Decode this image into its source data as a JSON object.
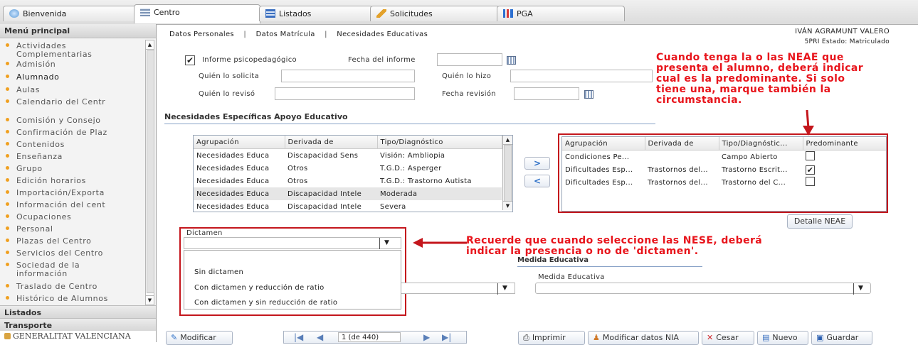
{
  "tabs": [
    {
      "label": "Bienvenida",
      "icon": "globe-icon"
    },
    {
      "label": "Centro",
      "icon": "grid-icon"
    },
    {
      "label": "Listados",
      "icon": "list-icon"
    },
    {
      "label": "Solicitudes",
      "icon": "pencil-icon"
    },
    {
      "label": "PGA",
      "icon": "bar-chart-icon"
    }
  ],
  "sidebar": {
    "title": "Menú principal",
    "items": [
      "Actividades",
      "Complementarias",
      "Admisión",
      "Alumnado",
      "Aulas",
      "Calendario del Centr",
      "Comisión y Consejo",
      "Confirmación de Plaz",
      "Contenidos",
      "Enseñanza",
      "Grupo",
      "Edición horarios",
      "Importación/Exporta",
      "Información del cent",
      "Ocupaciones",
      "Personal",
      "Plazas del Centro",
      "Servicios del Centro",
      "Sociedad de la",
      "información",
      "Traslado de Centro",
      "Histórico de Alumnos"
    ],
    "selected": "Alumnado",
    "sections": [
      "Listados",
      "Transporte"
    ],
    "footer": "GENERALITAT VALENCIANA"
  },
  "subnav": [
    "Datos Personales",
    "Datos Matrícula",
    "Necesidades Educativas"
  ],
  "student": {
    "name": "IVÁN AGRAMUNT VALERO",
    "status": "5PRI Estado: Matriculado"
  },
  "form": {
    "informe_label": "Informe psicopedagógico",
    "informe_checked": true,
    "fecha_informe_label": "Fecha del informe",
    "fecha_informe_value": "",
    "solicita_label": "Quién lo solicita",
    "solicita_value": "",
    "hizo_label": "Quién lo hizo",
    "hizo_value": "",
    "reviso_label": "Quién lo revisó",
    "reviso_value": "",
    "fecha_revision_label": "Fecha revisión",
    "fecha_revision_value": ""
  },
  "annotations": {
    "top_right": [
      "Cuando tenga la o las NEAE que",
      "presenta el alumno, deberá indicar",
      "cual es la predominante. Si solo",
      "tiene una, marque también la",
      "circumstancia."
    ],
    "middle": [
      "Recuerde que cuando seleccione las NESE, deberá",
      "indicar la presencia o no de 'dictamen'."
    ],
    "accent_color": "#e8141b"
  },
  "neae": {
    "section_title": "Necesidades Específicas Apoyo Educativo",
    "left_columns": [
      "Agrupación",
      "Derivada de",
      "Tipo/Diagnóstico"
    ],
    "left_rows": [
      [
        "Necesidades Educa",
        "Discapacidad Sens",
        "Visión: Ambliopia"
      ],
      [
        "Necesidades Educa",
        "Otros",
        "T.G.D.: Asperger"
      ],
      [
        "Necesidades Educa",
        "Otros",
        "T.G.D.: Trastorno Autista"
      ],
      [
        "Necesidades Educa",
        "Discapacidad Intele",
        "Moderada"
      ],
      [
        "Necesidades Educa",
        "Discapacidad Intele",
        "Severa"
      ]
    ],
    "move_right": ">",
    "move_left": "<",
    "right_columns": [
      "Agrupación",
      "Derivada de",
      "Tipo/Diagnóstic...",
      "Predominante"
    ],
    "right_rows": [
      {
        "agrupacion": "Condiciones Pe...",
        "derivada": "",
        "tipo": "Campo Abierto",
        "predominante": false
      },
      {
        "agrupacion": "Dificultades Esp...",
        "derivada": "Trastornos del...",
        "tipo": "Trastorno Escrit...",
        "predominante": true
      },
      {
        "agrupacion": "Dificultades Esp...",
        "derivada": "Trastornos del...",
        "tipo": "Trastorno del C...",
        "predominante": false
      }
    ],
    "detail_button": "Detalle NEAE"
  },
  "dictamen": {
    "label": "Dictamen",
    "selected": "",
    "options": [
      "Sin dictamen",
      "Con dictamen y reducción de ratio",
      "Con dictamen y sin reducción de ratio"
    ]
  },
  "medida": {
    "section_title": "Medida Educativa",
    "label": "Medida Educativa",
    "value": ""
  },
  "footer": {
    "modificar": "Modificar",
    "pager": "1 (de 440)",
    "imprimir": "Imprimir",
    "modificar_nia": "Modificar datos NIA",
    "cesar": "Cesar",
    "nuevo": "Nuevo",
    "guardar": "Guardar"
  }
}
